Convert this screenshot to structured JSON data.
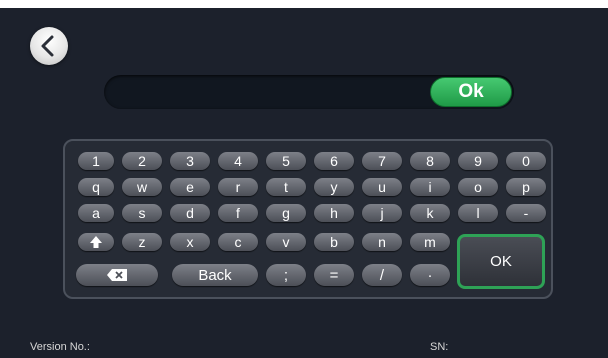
{
  "nav": {
    "back_icon": "chevron-left-icon"
  },
  "input": {
    "value": "",
    "placeholder": "",
    "confirm_label": "Ok"
  },
  "keyboard": {
    "row1": [
      "1",
      "2",
      "3",
      "4",
      "5",
      "6",
      "7",
      "8",
      "9",
      "0"
    ],
    "row2": [
      "q",
      "w",
      "e",
      "r",
      "t",
      "y",
      "u",
      "i",
      "o",
      "p"
    ],
    "row3": [
      "a",
      "s",
      "d",
      "f",
      "g",
      "h",
      "j",
      "k",
      "l",
      "-"
    ],
    "row4": [
      "z",
      "x",
      "c",
      "v",
      "b",
      "n",
      "m"
    ],
    "shift_icon": "shift-arrow-icon",
    "backspace_icon": "backspace-icon",
    "back_label": "Back",
    "semicolon": ";",
    "equals": "=",
    "slash": "/",
    "dot": "·",
    "ok_label": "OK"
  },
  "footer": {
    "version_label": "Version No.:",
    "sn_label": "SN:"
  },
  "colors": {
    "background": "#1c212c",
    "accent_green": "#2ea256",
    "key_gray": "#5d6068"
  }
}
